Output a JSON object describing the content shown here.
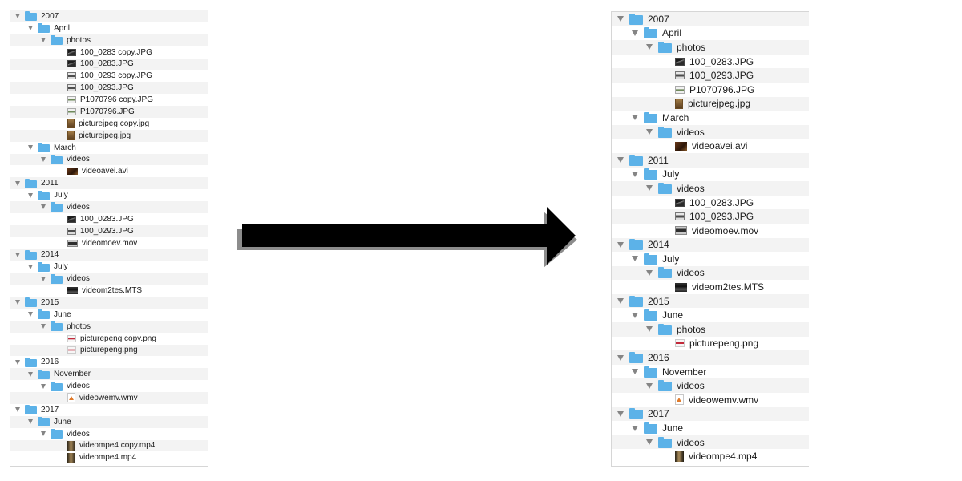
{
  "before_tree": [
    {
      "label": "2007",
      "type": "folder",
      "level": 0
    },
    {
      "label": "April",
      "type": "folder",
      "level": 1
    },
    {
      "label": "photos",
      "type": "folder",
      "level": 2
    },
    {
      "label": "100_0283 copy.JPG",
      "type": "file",
      "icon": "photo-dark",
      "level": 3
    },
    {
      "label": "100_0283.JPG",
      "type": "file",
      "icon": "photo-dark",
      "level": 3
    },
    {
      "label": "100_0293 copy.JPG",
      "type": "file",
      "icon": "photo-grey",
      "level": 3
    },
    {
      "label": "100_0293.JPG",
      "type": "file",
      "icon": "photo-grey",
      "level": 3
    },
    {
      "label": "P1070796 copy.JPG",
      "type": "file",
      "icon": "photo-light",
      "level": 3
    },
    {
      "label": "P1070796.JPG",
      "type": "file",
      "icon": "photo-light",
      "level": 3
    },
    {
      "label": "picturejpeg copy.jpg",
      "type": "file",
      "icon": "jpeg-frame",
      "level": 3
    },
    {
      "label": "picturejpeg.jpg",
      "type": "file",
      "icon": "jpeg-frame",
      "level": 3
    },
    {
      "label": "March",
      "type": "folder",
      "level": 1
    },
    {
      "label": "videos",
      "type": "folder",
      "level": 2
    },
    {
      "label": "videoavei.avi",
      "type": "file",
      "icon": "avi",
      "level": 3
    },
    {
      "label": "2011",
      "type": "folder",
      "level": 0
    },
    {
      "label": "July",
      "type": "folder",
      "level": 1
    },
    {
      "label": "videos",
      "type": "folder",
      "level": 2
    },
    {
      "label": "100_0283.JPG",
      "type": "file",
      "icon": "photo-dark",
      "level": 3
    },
    {
      "label": "100_0293.JPG",
      "type": "file",
      "icon": "photo-grey",
      "level": 3
    },
    {
      "label": "videomoev.mov",
      "type": "file",
      "icon": "mov",
      "level": 3
    },
    {
      "label": "2014",
      "type": "folder",
      "level": 0
    },
    {
      "label": "July",
      "type": "folder",
      "level": 1
    },
    {
      "label": "videos",
      "type": "folder",
      "level": 2
    },
    {
      "label": "videom2tes.MTS",
      "type": "file",
      "icon": "mts",
      "level": 3
    },
    {
      "label": "2015",
      "type": "folder",
      "level": 0
    },
    {
      "label": "June",
      "type": "folder",
      "level": 1
    },
    {
      "label": "photos",
      "type": "folder",
      "level": 2
    },
    {
      "label": "picturepeng copy.png",
      "type": "file",
      "icon": "png",
      "level": 3
    },
    {
      "label": "picturepeng.png",
      "type": "file",
      "icon": "png",
      "level": 3
    },
    {
      "label": "2016",
      "type": "folder",
      "level": 0
    },
    {
      "label": "November",
      "type": "folder",
      "level": 1
    },
    {
      "label": "videos",
      "type": "folder",
      "level": 2
    },
    {
      "label": "videowemv.wmv",
      "type": "file",
      "icon": "wmv",
      "level": 3
    },
    {
      "label": "2017",
      "type": "folder",
      "level": 0
    },
    {
      "label": "June",
      "type": "folder",
      "level": 1
    },
    {
      "label": "videos",
      "type": "folder",
      "level": 2
    },
    {
      "label": "videompe4 copy.mp4",
      "type": "file",
      "icon": "mp4",
      "level": 3
    },
    {
      "label": "videompe4.mp4",
      "type": "file",
      "icon": "mp4",
      "level": 3
    }
  ],
  "after_tree": [
    {
      "label": "2007",
      "type": "folder",
      "level": 0
    },
    {
      "label": "April",
      "type": "folder",
      "level": 1
    },
    {
      "label": "photos",
      "type": "folder",
      "level": 2
    },
    {
      "label": "100_0283.JPG",
      "type": "file",
      "icon": "photo-dark",
      "level": 3
    },
    {
      "label": "100_0293.JPG",
      "type": "file",
      "icon": "photo-grey",
      "level": 3
    },
    {
      "label": "P1070796.JPG",
      "type": "file",
      "icon": "photo-light",
      "level": 3
    },
    {
      "label": "picturejpeg.jpg",
      "type": "file",
      "icon": "jpeg-frame",
      "level": 3
    },
    {
      "label": "March",
      "type": "folder",
      "level": 1
    },
    {
      "label": "videos",
      "type": "folder",
      "level": 2
    },
    {
      "label": "videoavei.avi",
      "type": "file",
      "icon": "avi",
      "level": 3
    },
    {
      "label": "2011",
      "type": "folder",
      "level": 0
    },
    {
      "label": "July",
      "type": "folder",
      "level": 1
    },
    {
      "label": "videos",
      "type": "folder",
      "level": 2
    },
    {
      "label": "100_0283.JPG",
      "type": "file",
      "icon": "photo-dark",
      "level": 3
    },
    {
      "label": "100_0293.JPG",
      "type": "file",
      "icon": "photo-grey",
      "level": 3
    },
    {
      "label": "videomoev.mov",
      "type": "file",
      "icon": "mov",
      "level": 3
    },
    {
      "label": "2014",
      "type": "folder",
      "level": 0
    },
    {
      "label": "July",
      "type": "folder",
      "level": 1
    },
    {
      "label": "videos",
      "type": "folder",
      "level": 2
    },
    {
      "label": "videom2tes.MTS",
      "type": "file",
      "icon": "mts",
      "level": 3
    },
    {
      "label": "2015",
      "type": "folder",
      "level": 0
    },
    {
      "label": "June",
      "type": "folder",
      "level": 1
    },
    {
      "label": "photos",
      "type": "folder",
      "level": 2
    },
    {
      "label": "picturepeng.png",
      "type": "file",
      "icon": "png",
      "level": 3
    },
    {
      "label": "2016",
      "type": "folder",
      "level": 0
    },
    {
      "label": "November",
      "type": "folder",
      "level": 1
    },
    {
      "label": "videos",
      "type": "folder",
      "level": 2
    },
    {
      "label": "videowemv.wmv",
      "type": "file",
      "icon": "wmv",
      "level": 3
    },
    {
      "label": "2017",
      "type": "folder",
      "level": 0
    },
    {
      "label": "June",
      "type": "folder",
      "level": 1
    },
    {
      "label": "videos",
      "type": "folder",
      "level": 2
    },
    {
      "label": "videompe4.mp4",
      "type": "file",
      "icon": "mp4",
      "level": 3
    }
  ],
  "colors": {
    "folder": "#5cb2e8",
    "row_alt": "#f3f3f3",
    "disclosure": "#858585",
    "arrow": "#000000"
  },
  "icons": {
    "disclosure": "triangle-down-icon",
    "folder": "folder-icon",
    "transition": "arrow-right-icon"
  }
}
